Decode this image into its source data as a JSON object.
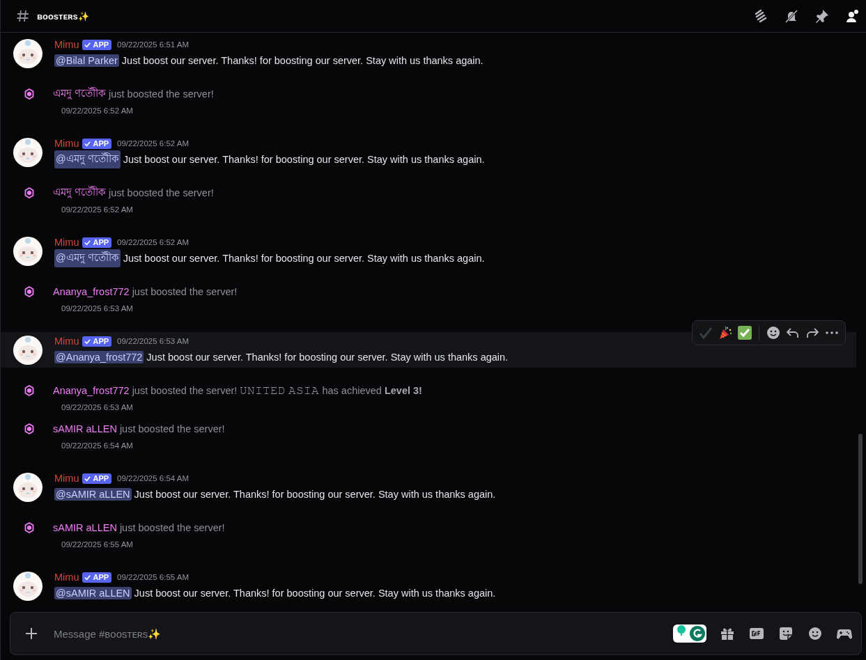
{
  "channel": {
    "name": "ʙᴏᴏsᴛᴇʀs✨"
  },
  "messages": [
    {
      "kind": "app",
      "author": "Mimu",
      "badge": "APP",
      "time": "09/22/2025 6:51 AM",
      "mention": "@Bilal Parker",
      "text": "Just boost our server. Thanks! for boosting our server. Stay with us thanks again.",
      "hovered": false
    },
    {
      "kind": "boost",
      "user": "এমদু ণতৌীক",
      "text": "just boosted the server!",
      "time": "09/22/2025 6:52 AM"
    },
    {
      "kind": "app",
      "author": "Mimu",
      "badge": "APP",
      "time": "09/22/2025 6:52 AM",
      "mention": "@এমদু ণতৌীক",
      "text": "Just boost our server. Thanks! for boosting our server. Stay with us thanks again.",
      "hovered": false
    },
    {
      "kind": "boost",
      "user": "এমদু ণতৌীক",
      "text": "just boosted the server!",
      "time": "09/22/2025 6:52 AM"
    },
    {
      "kind": "app",
      "author": "Mimu",
      "badge": "APP",
      "time": "09/22/2025 6:52 AM",
      "mention": "@এমদু ণতৌীক",
      "text": "Just boost our server. Thanks! for boosting our server. Stay with us thanks again.",
      "hovered": false
    },
    {
      "kind": "boost",
      "user": "Ananya_frost772",
      "text": "just boosted the server!",
      "time": "09/22/2025 6:53 AM"
    },
    {
      "kind": "app",
      "author": "Mimu",
      "badge": "APP",
      "time": "09/22/2025 6:53 AM",
      "mention": "@Ananya_frost772",
      "text": "Just boost our server. Thanks! for boosting our server. Stay with us thanks again.",
      "hovered": true
    },
    {
      "kind": "boost",
      "user": "Ananya_frost772",
      "text": "just boosted the server! 𝚄𝙽𝙸𝚃𝙴𝙳 𝙰𝚂𝙸𝙰 has achieved **Level 3!**",
      "time": "09/22/2025 6:53 AM"
    },
    {
      "kind": "boost",
      "user": "sAMIR aLLEN",
      "text": "just boosted the server!",
      "time": "09/22/2025 6:54 AM"
    },
    {
      "kind": "app",
      "author": "Mimu",
      "badge": "APP",
      "time": "09/22/2025 6:54 AM",
      "mention": "@sAMIR aLLEN",
      "text": "Just boost our server. Thanks! for boosting our server. Stay with us thanks again.",
      "hovered": false
    },
    {
      "kind": "boost",
      "user": "sAMIR aLLEN",
      "text": "just boosted the server!",
      "time": "09/22/2025 6:55 AM"
    },
    {
      "kind": "app",
      "author": "Mimu",
      "badge": "APP",
      "time": "09/22/2025 6:55 AM",
      "mention": "@sAMIR aLLEN",
      "text": "Just boost our server. Thanks! for boosting our server. Stay with us thanks again.",
      "hovered": false
    }
  ],
  "composer": {
    "placeholder": "Message #ʙᴏᴏsᴛᴇʀs✨"
  }
}
